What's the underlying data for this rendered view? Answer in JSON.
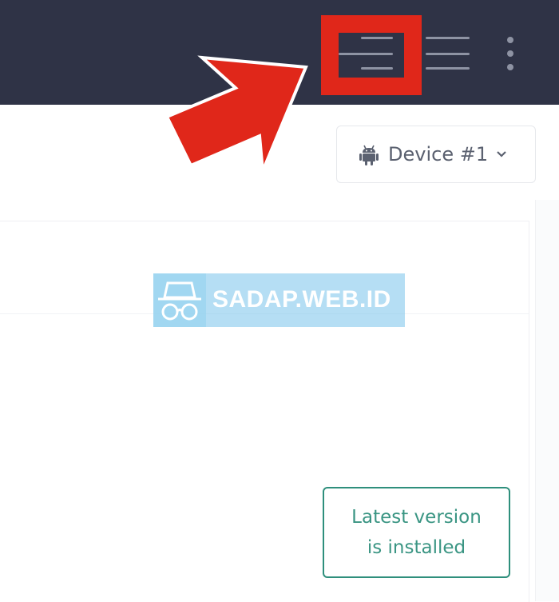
{
  "topbar": {
    "icons": [
      "sort-lines-icon",
      "menu-lines-icon",
      "kebab-menu-icon"
    ]
  },
  "device_selector": {
    "icon": "android-icon",
    "label": "Device #1",
    "chevron": "chevron-down-icon"
  },
  "watermark": {
    "logo": "incognito-icon",
    "text": "SADAP.WEB.ID"
  },
  "status_button": {
    "line1": "Latest version",
    "line2": "is installed"
  },
  "colors": {
    "topbar_bg": "#2f3346",
    "highlight_red": "#e0271a",
    "accent_teal": "#2e8f7c"
  }
}
